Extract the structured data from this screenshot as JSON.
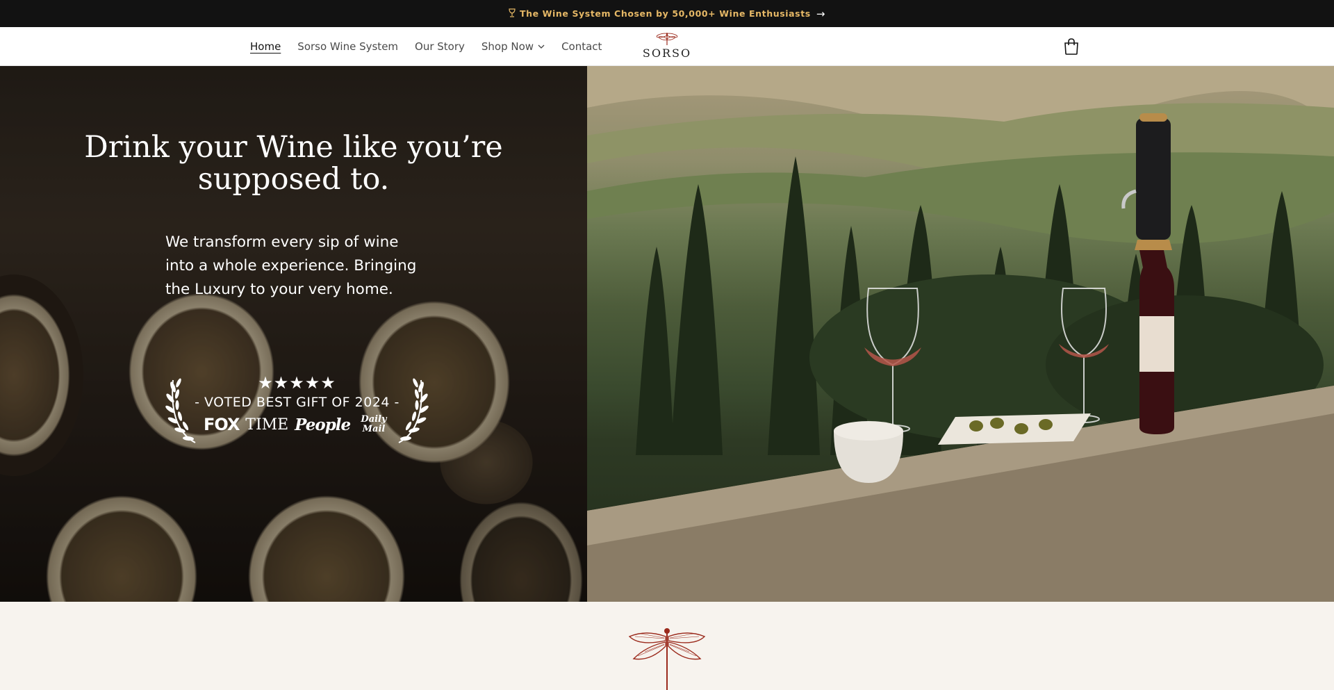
{
  "announcement": {
    "icon": "wine-glass-icon",
    "text": "The Wine System Chosen by 50,000+ Wine Enthusiasts",
    "arrow": "→"
  },
  "nav": {
    "items": [
      {
        "label": "Home",
        "active": true
      },
      {
        "label": "Sorso Wine System",
        "active": false
      },
      {
        "label": "Our Story",
        "active": false
      },
      {
        "label": "Shop Now",
        "active": false,
        "has_dropdown": true
      },
      {
        "label": "Contact",
        "active": false
      }
    ],
    "logo_text": "SORSO",
    "cart_icon": "cart-icon"
  },
  "hero": {
    "title": "Drink your Wine like you’re supposed to.",
    "subtitle": "We transform every sip of wine into a whole experience. Bringing the Luxury to your very home.",
    "award": {
      "stars": "★★★★★",
      "voted": "- VOTED BEST GIFT OF 2024 -",
      "press": [
        "FOX",
        "TIME",
        "People",
        "Daily Mail"
      ]
    }
  },
  "colors": {
    "announcement_bg": "#121212",
    "announcement_text": "#e6b866",
    "brand_red": "#9b2a1c",
    "beige": "#f7f3ee"
  }
}
